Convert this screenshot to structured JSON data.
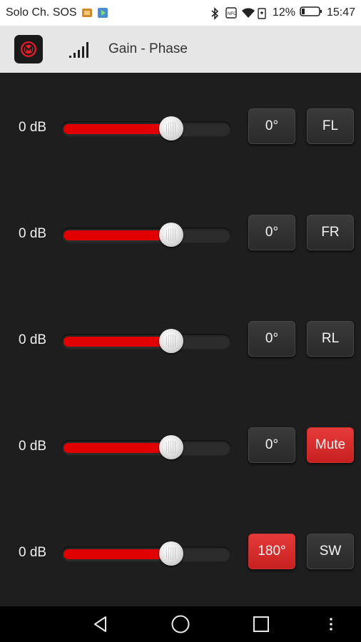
{
  "status_bar": {
    "carrier": "Solo Ch. SOS",
    "battery": "12%",
    "time": "15:47"
  },
  "app_bar": {
    "title": "Gain - Phase"
  },
  "channels": [
    {
      "gain_label": "0 dB",
      "gain_level": 0.65,
      "phase_label": "0°",
      "phase_active": false,
      "channel_label": "FL",
      "channel_active": false
    },
    {
      "gain_label": "0 dB",
      "gain_level": 0.65,
      "phase_label": "0°",
      "phase_active": false,
      "channel_label": "FR",
      "channel_active": false
    },
    {
      "gain_label": "0 dB",
      "gain_level": 0.65,
      "phase_label": "0°",
      "phase_active": false,
      "channel_label": "RL",
      "channel_active": false
    },
    {
      "gain_label": "0 dB",
      "gain_level": 0.65,
      "phase_label": "0°",
      "phase_active": false,
      "channel_label": "Mute",
      "channel_active": true
    },
    {
      "gain_label": "0 dB",
      "gain_level": 0.65,
      "phase_label": "180°",
      "phase_active": true,
      "channel_label": "SW",
      "channel_active": false
    }
  ],
  "colors": {
    "accent": "#e00000",
    "active_button": "#d32f2f",
    "background": "#1e1e1e"
  },
  "navbar": {
    "icons": [
      "back-icon",
      "home-icon",
      "recents-icon",
      "more-icon"
    ]
  }
}
